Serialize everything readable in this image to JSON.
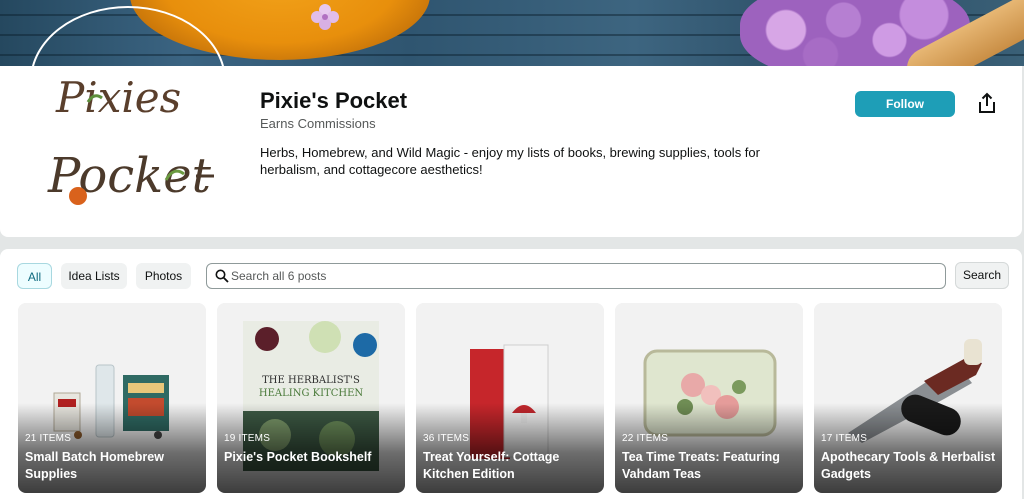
{
  "profile": {
    "name": "Pixie's Pocket",
    "subtitle": "Earns Commissions",
    "bio": "Herbs, Homebrew, and Wild Magic - enjoy my lists of books, brewing supplies, tools for herbalism, and cottagecore aesthetics!",
    "logo_text_line1": "Pixies",
    "logo_text_line2": "Pocket",
    "follow_label": "Follow",
    "share_icon": "share-icon"
  },
  "filters": [
    {
      "label": "All",
      "active": true
    },
    {
      "label": "Idea Lists",
      "active": false
    },
    {
      "label": "Photos",
      "active": false
    }
  ],
  "search": {
    "placeholder": "Search all 6 posts",
    "button_label": "Search"
  },
  "posts": [
    {
      "count": "21 ITEMS",
      "title": "Small Batch Homebrew Supplies",
      "book_title": ""
    },
    {
      "count": "19 ITEMS",
      "title": "Pixie's Pocket Bookshelf",
      "book_title": "THE HERBALIST'S HEALING KITCHEN"
    },
    {
      "count": "36 ITEMS",
      "title": "Treat Yourself: Cottage Kitchen Edition",
      "book_title": ""
    },
    {
      "count": "22 ITEMS",
      "title": "Tea Time Treats: Featuring Vahdam Teas",
      "book_title": ""
    },
    {
      "count": "17 ITEMS",
      "title": "Apothecary Tools & Herbalist Gadgets",
      "book_title": ""
    }
  ],
  "colors": {
    "accent": "#1e9eb7",
    "page_bg": "#e3e6e6"
  }
}
